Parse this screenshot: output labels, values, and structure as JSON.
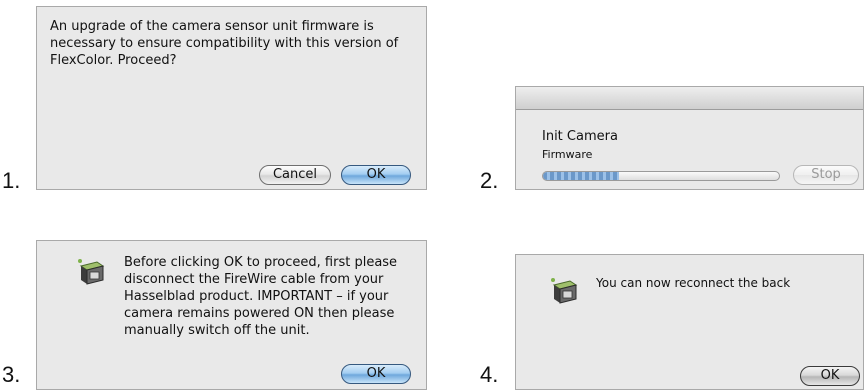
{
  "steps": [
    {
      "number": "1.",
      "message": "An upgrade of the camera sensor unit firmware is necessary to ensure compatibility with this version of FlexColor. Proceed?",
      "cancel_label": "Cancel",
      "ok_label": "OK"
    },
    {
      "number": "2.",
      "title": "Init Camera",
      "subtitle": "Firmware",
      "progress": 0.32,
      "stop_label": "Stop"
    },
    {
      "number": "3.",
      "icon": "flexcolor-camera-icon",
      "message": "Before clicking OK to proceed, first please disconnect the FireWire cable from your Hasselblad product. IMPORTANT – if your camera remains powered ON then please manually switch off the unit.",
      "ok_label": "OK"
    },
    {
      "number": "4.",
      "icon": "flexcolor-camera-icon",
      "message": "You can now reconnect the back",
      "ok_label": "OK"
    }
  ],
  "colors": {
    "dialog_bg": "#e9e9e9",
    "default_button": "#6fa8dc",
    "progress": "#6b98c9"
  }
}
